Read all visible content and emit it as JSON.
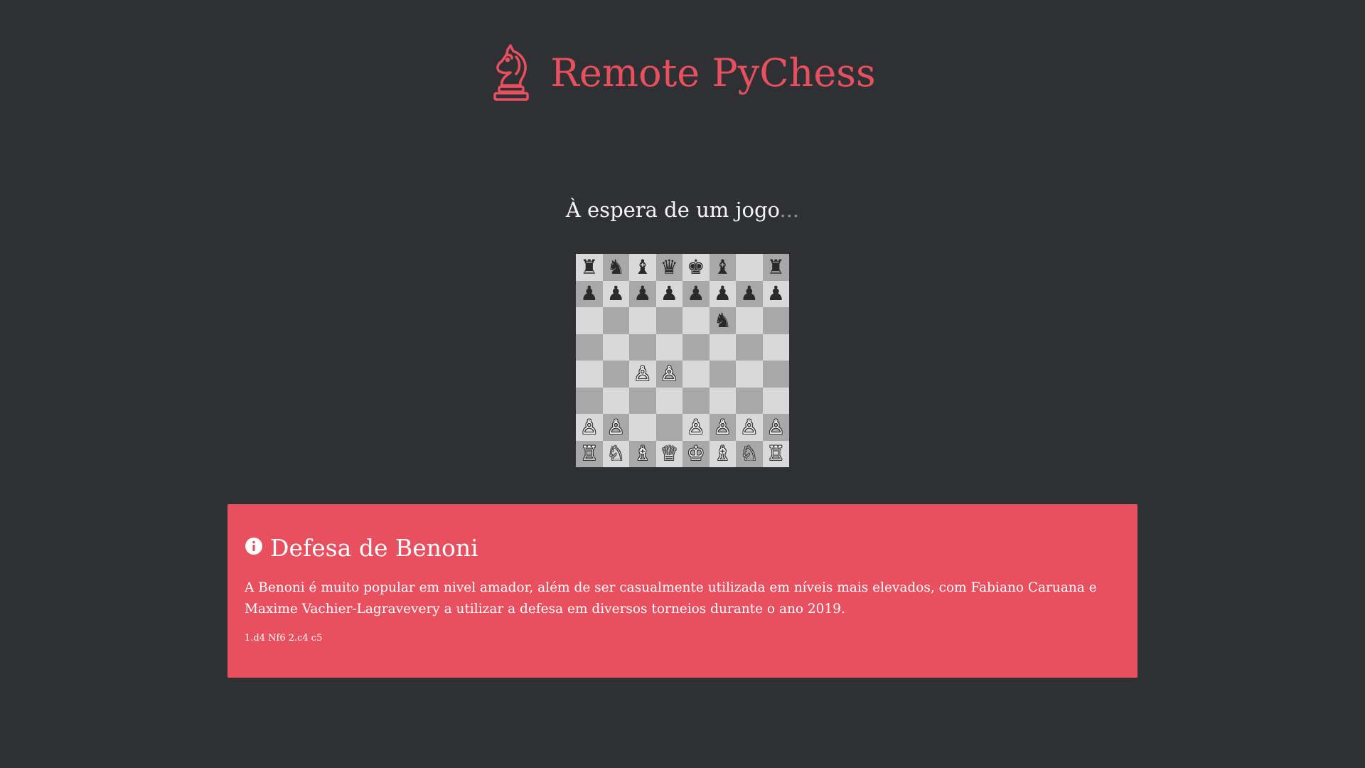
{
  "header": {
    "title": "Remote PyChess",
    "logo_icon": "knight-icon",
    "accent_color": "#e84f5f"
  },
  "status": {
    "text": "À espera de um jogo",
    "dots": "..."
  },
  "board": {
    "ranks": [
      [
        "♜",
        "♞",
        "♝",
        "♛",
        "♚",
        "♝",
        "",
        "♜"
      ],
      [
        "♟",
        "♟",
        "♟",
        "♟",
        "♟",
        "♟",
        "♟",
        "♟"
      ],
      [
        "",
        "",
        "",
        "",
        "",
        "♞",
        "",
        ""
      ],
      [
        "",
        "",
        "",
        "",
        "",
        "",
        "",
        ""
      ],
      [
        "",
        "",
        "♙",
        "♙",
        "",
        "",
        "",
        ""
      ],
      [
        "",
        "",
        "",
        "",
        "",
        "",
        "",
        ""
      ],
      [
        "♙",
        "♙",
        "",
        "",
        "♙",
        "♙",
        "♙",
        "♙"
      ],
      [
        "♖",
        "♘",
        "♗",
        "♕",
        "♔",
        "♗",
        "♘",
        "♖"
      ]
    ]
  },
  "opening": {
    "icon": "info-icon",
    "title": "Defesa de Benoni",
    "description": "A Benoni é muito popular em nivel amador, além de ser casualmente utilizada em níveis mais elevados, com Fabiano Caruana e Maxime Vachier-Lagravevery a utilizar a defesa em diversos torneios durante o ano 2019.",
    "moves": "1.d4 Nf6 2.c4 c5"
  }
}
